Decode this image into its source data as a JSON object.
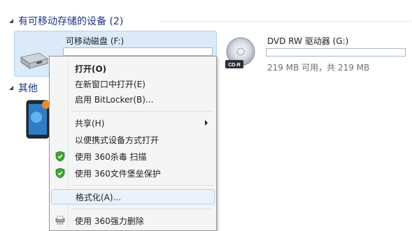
{
  "groups": {
    "removable_header": "有可移动存储的设备 (2)",
    "other_header": "其他"
  },
  "drives": {
    "usb_name": "可移动磁盘 (F:)",
    "dvd_name": "DVD RW 驱动器 (G:)",
    "dvd_free": "219 MB 可用，共 219 MB",
    "dvd_disc_label": "CD-R"
  },
  "context_menu": {
    "open": "打开(O)",
    "open_new_window": "在新窗口中打开(E)",
    "bitlocker": "启用 BitLocker(B)...",
    "share": "共享(H)",
    "portable_open": "以便携式设备方式打开",
    "scan_360": "使用 360杀毒 扫描",
    "protect_360": "使用 360文件堡垒保护",
    "format": "格式化(A)...",
    "force_delete_360": "使用 360强力删除"
  },
  "colors": {
    "header_text": "#1e3287",
    "selection_fill": "#dbeaf8",
    "menu_hover": "#eaf2fb",
    "shield_green": "#3fa33a"
  }
}
